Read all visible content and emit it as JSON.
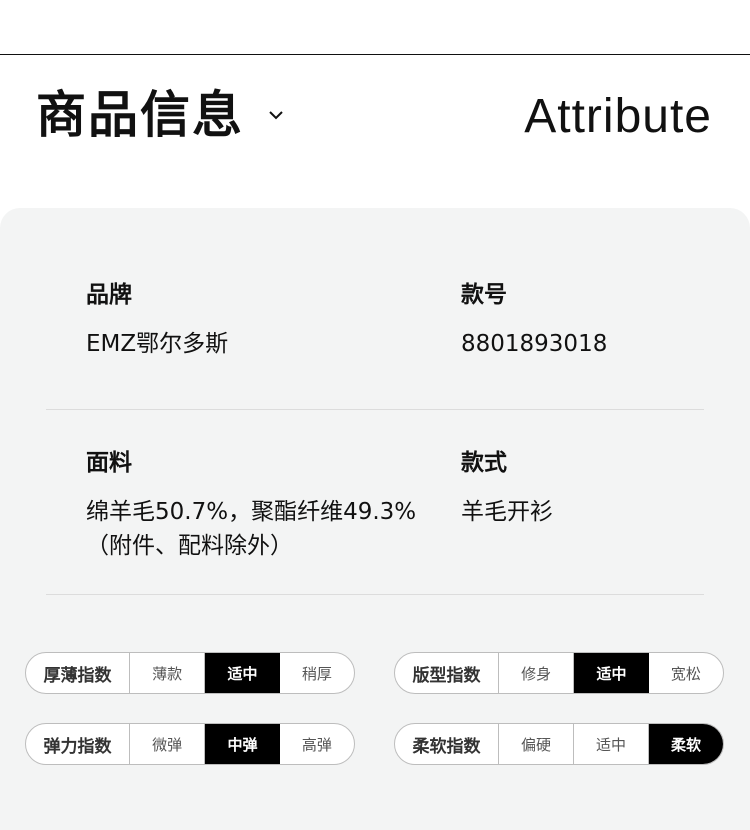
{
  "header": {
    "title": "商品信息",
    "subtitle": "Attribute",
    "toggle_icon": "chevron-down-icon"
  },
  "info": {
    "brand_label": "品牌",
    "brand_value": "EMZ鄂尔多斯",
    "style_no_label": "款号",
    "style_no_value": "8801893018",
    "fabric_label": "面料",
    "fabric_value_line1": "绵羊毛50.7%，聚酯纤维49.3%",
    "fabric_value_line2": "（附件、配料除外）",
    "style_label": "款式",
    "style_value": "羊毛开衫"
  },
  "indices": [
    {
      "name": "厚薄指数",
      "options": [
        "薄款",
        "适中",
        "稍厚"
      ],
      "selected": 1
    },
    {
      "name": "版型指数",
      "options": [
        "修身",
        "适中",
        "宽松"
      ],
      "selected": 1
    },
    {
      "name": "弹力指数",
      "options": [
        "微弹",
        "中弹",
        "高弹"
      ],
      "selected": 1
    },
    {
      "name": "柔软指数",
      "options": [
        "偏硬",
        "适中",
        "柔软"
      ],
      "selected": 2
    }
  ],
  "colors": {
    "panel_bg": "#f3f4f4",
    "selected_bg": "#000000",
    "selected_text": "#ffffff"
  }
}
